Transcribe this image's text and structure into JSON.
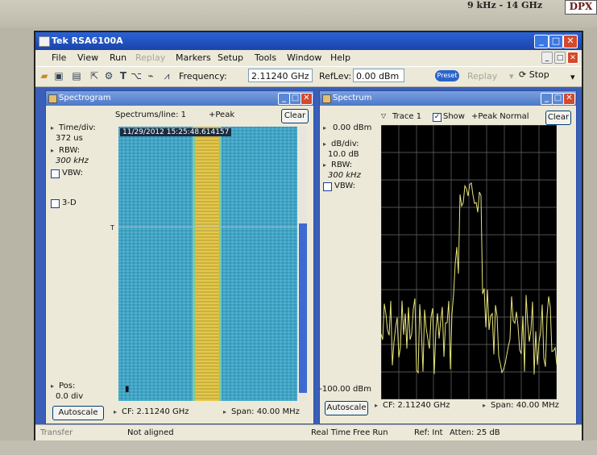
{
  "app": {
    "title": "Tek RSA6100A"
  },
  "bezel": {
    "model": "9 kHz - 14 GHz",
    "badge": "DPX"
  },
  "menu": [
    "File",
    "View",
    "Run",
    "Replay",
    "Markers",
    "Setup",
    "Tools",
    "Window",
    "Help"
  ],
  "toolbar": {
    "frequency_label": "Frequency:",
    "frequency_value": "2.11240 GHz",
    "reflev_label": "RefLev:",
    "reflev_value": "0.00 dBm",
    "preset_label": "Preset",
    "replay_label": "Replay",
    "stop_label": "Stop"
  },
  "spectrogram": {
    "title": "Spectrogram",
    "spectrums_per_line": "Spectrums/line: 1",
    "detector": "+Peak",
    "clear": "Clear",
    "time_div_label": "Time/div:",
    "time_div_value": "372 us",
    "rbw_label": "RBW:",
    "rbw_value": "300 kHz",
    "vbw_label": "VBW:",
    "three_d_label": "3-D",
    "timestamp": "11/29/2012 15:25:48.614157",
    "pos_label": "Pos:",
    "pos_value": "0.0 div",
    "autoscale": "Autoscale",
    "cf": "CF: 2.11240 GHz",
    "span": "Span: 40.00 MHz"
  },
  "spectrum": {
    "title": "Spectrum",
    "trace": "Trace 1",
    "show_label": "Show",
    "detector": "+Peak Normal",
    "clear": "Clear",
    "ref_level": "0.00 dBm",
    "db_div_label": "dB/div:",
    "db_div_value": "10.0 dB",
    "rbw_label": "RBW:",
    "rbw_value": "300 kHz",
    "vbw_label": "VBW:",
    "bottom_level": "-100.00 dBm",
    "autoscale": "Autoscale",
    "cf": "CF: 2.11240 GHz",
    "span": "Span: 40.00 MHz",
    "trace_color": "#e7e57a"
  },
  "status": {
    "left": "Transfer",
    "alignment": "Not aligned",
    "mode": "Real Time",
    "run": "Free Run",
    "ref": "Ref: Int",
    "atten": "Atten: 25 dB"
  }
}
